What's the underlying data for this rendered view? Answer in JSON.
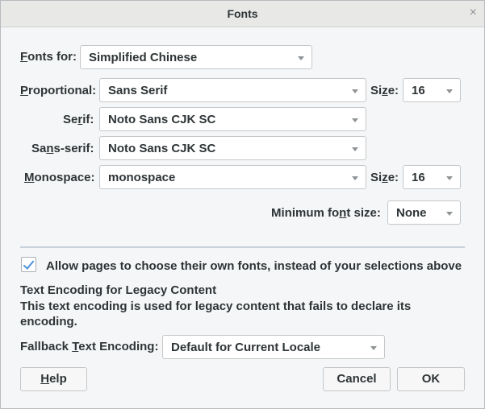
{
  "window": {
    "title": "Fonts",
    "close_glyph": "×"
  },
  "fonts_for": {
    "label_a": "F",
    "label_b": "onts for:",
    "value": "Simplified Chinese"
  },
  "proportional": {
    "label_a": "P",
    "label_b": "roportional:",
    "value": "Sans Serif",
    "size_label_a": "Si",
    "size_label_u": "z",
    "size_label_b": "e:",
    "size_value": "16"
  },
  "serif": {
    "label_a": "Se",
    "label_u": "r",
    "label_b": "if:",
    "value": "Noto Sans CJK SC"
  },
  "sans_serif": {
    "label_a": "Sa",
    "label_u": "n",
    "label_b": "s-serif:",
    "value": "Noto Sans CJK SC"
  },
  "monospace": {
    "label_a": "M",
    "label_b": "onospace:",
    "value": "monospace",
    "size_label_a": "Si",
    "size_label_u": "z",
    "size_label_b": "e:",
    "size_value": "16"
  },
  "min_font_size": {
    "label_a": "Minimum fo",
    "label_u": "n",
    "label_b": "t size:",
    "value": "None"
  },
  "allow_pages": {
    "checked": true,
    "label": "Allow pages to choose their own fonts, instead of your selections above"
  },
  "legacy": {
    "heading": "Text Encoding for Legacy Content",
    "desc_line1": "This text encoding is used for legacy content that fails to declare its",
    "desc_line2": "encoding.",
    "fallback_label_a": "Fallback ",
    "fallback_label_u": "T",
    "fallback_label_b": "ext Encoding:",
    "fallback_value": "Default for Current Locale"
  },
  "buttons": {
    "help_u": "H",
    "help_b": "elp",
    "cancel": "Cancel",
    "ok": "OK"
  }
}
